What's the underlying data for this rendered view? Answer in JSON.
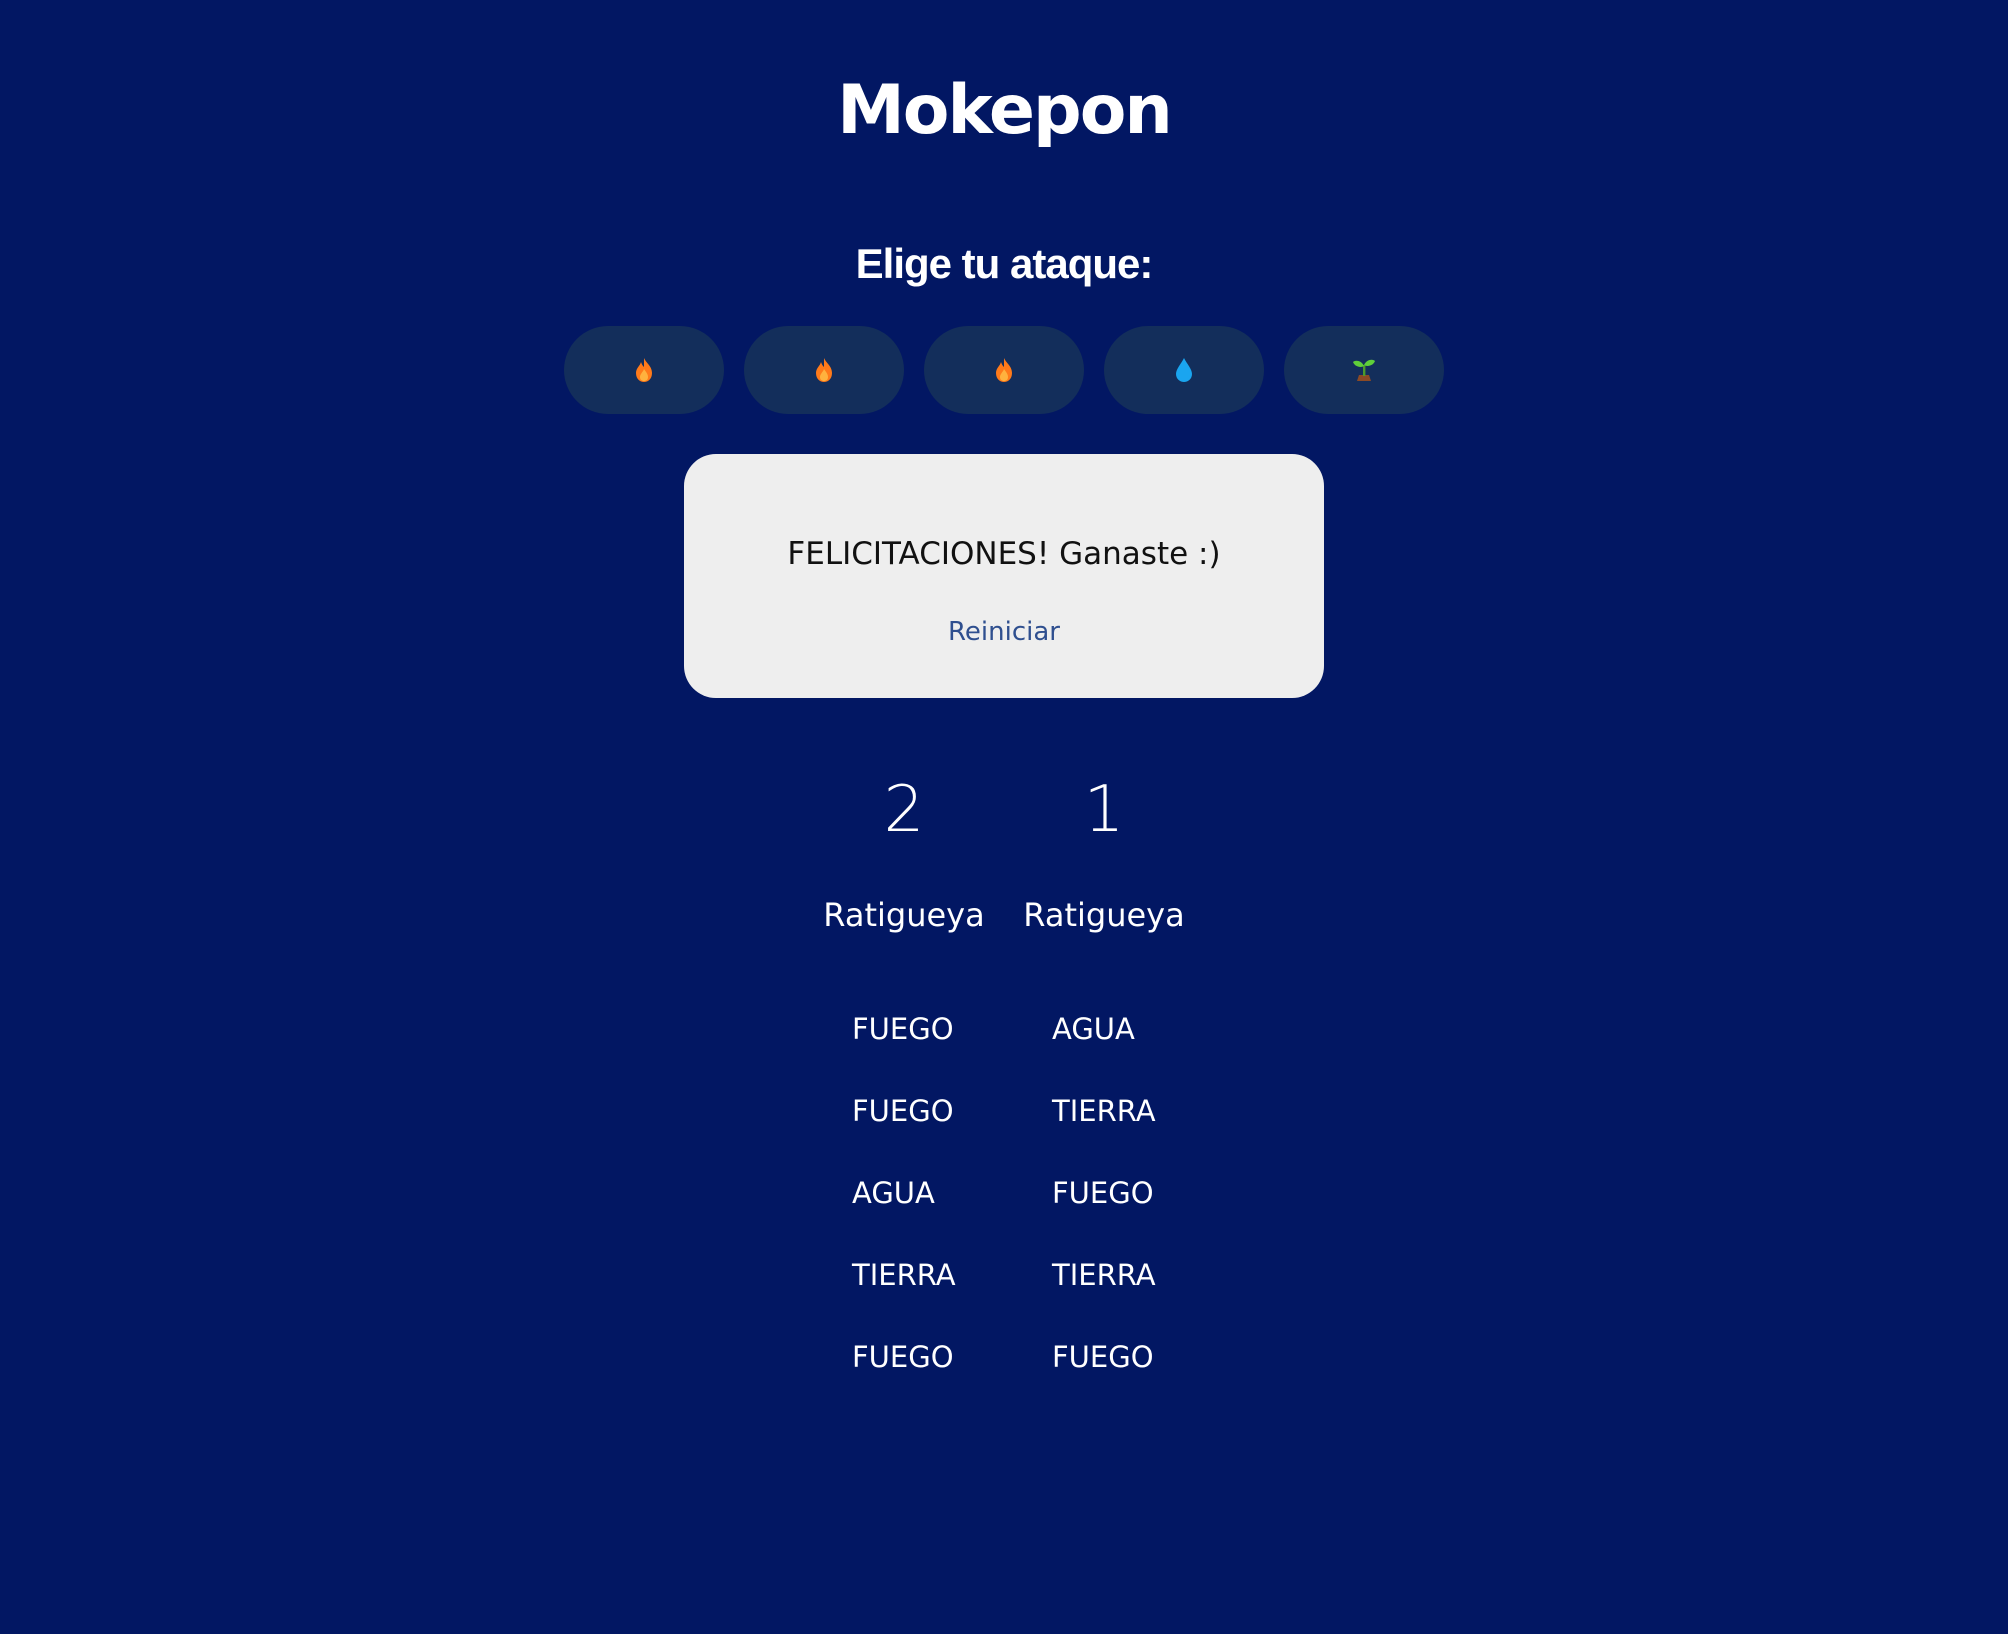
{
  "app": {
    "title": "Mokepon",
    "colors": {
      "background": "#021763",
      "button_background": "#132e5b",
      "card_background": "#eeeeee",
      "card_text": "#111111",
      "link": "#2f4f8f",
      "text": "#ffffff",
      "fire": "#ff7a1a",
      "water": "#1aa5ef",
      "plant": "#5fcf3a"
    }
  },
  "attack_section": {
    "heading": "Elige tu ataque:",
    "buttons": [
      {
        "icon": "fire-icon"
      },
      {
        "icon": "fire-icon"
      },
      {
        "icon": "fire-icon"
      },
      {
        "icon": "water-drop-icon"
      },
      {
        "icon": "plant-sprout-icon"
      }
    ]
  },
  "result": {
    "message": "FELICITACIONES! Ganaste :)",
    "restart_label": "Reiniciar"
  },
  "player": {
    "lives": "2",
    "pet": "Ratigueya",
    "attacks": [
      "FUEGO",
      "FUEGO",
      "AGUA",
      "TIERRA",
      "FUEGO"
    ]
  },
  "enemy": {
    "lives": "1",
    "pet": "Ratigueya",
    "attacks": [
      "AGUA",
      "TIERRA",
      "FUEGO",
      "TIERRA",
      "FUEGO"
    ]
  }
}
